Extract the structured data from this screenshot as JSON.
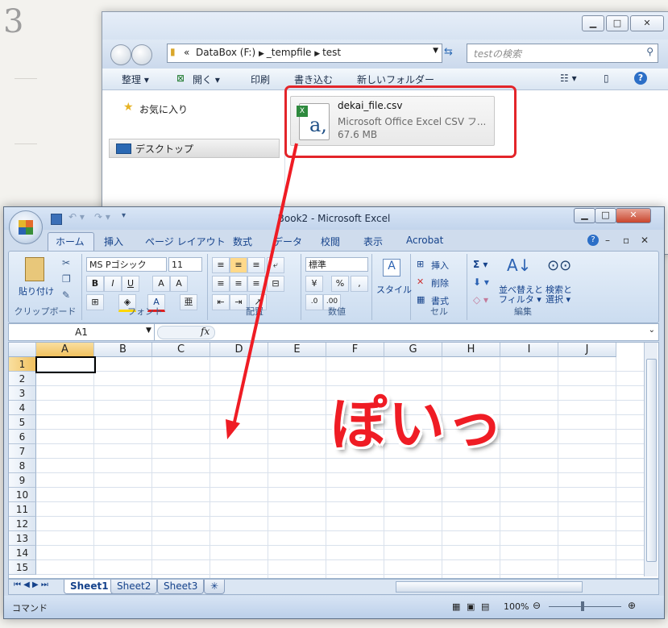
{
  "step_number": "3",
  "overlay_text": "ぽいっ",
  "explorer": {
    "address": {
      "prefix": "«",
      "crumbs": [
        "DataBox (F:)",
        "_tempfile",
        "test"
      ]
    },
    "search_placeholder": "testの検索",
    "commands": {
      "organize": "整理 ▾",
      "open": "開く ▾",
      "print": "印刷",
      "burn": "書き込む",
      "new_folder": "新しいフォルダー"
    },
    "nav": {
      "favorites": "お気に入り",
      "desktop": "デスクトップ"
    },
    "file": {
      "name": "dekai_file.csv",
      "type": "Microsoft Office Excel CSV フ...",
      "size": "67.6 MB",
      "icon": "excel-csv-icon"
    }
  },
  "excel": {
    "title": "Book2 - Microsoft Excel",
    "tabs": [
      "ホーム",
      "挿入",
      "ページ レイアウト",
      "数式",
      "データ",
      "校閲",
      "表示",
      "Acrobat"
    ],
    "ribbon": {
      "paste": "貼り付け",
      "clipboard": "クリップボード",
      "font_name": "MS Pゴシック",
      "font_size": "11",
      "font_group": "フォント",
      "align_group": "配置",
      "number_format": "標準",
      "number_group": "数値",
      "style": "スタイル",
      "insert": "挿入",
      "delete": "削除",
      "format": "書式",
      "cell_group": "セル",
      "sort_filter_1": "並べ替えと",
      "sort_filter_2": "フィルタ ▾",
      "find_select_1": "検索と",
      "find_select_2": "選択 ▾",
      "edit_group": "編集"
    },
    "name_box": "A1",
    "fx": "fx",
    "columns": [
      "A",
      "B",
      "C",
      "D",
      "E",
      "F",
      "G",
      "H",
      "I",
      "J"
    ],
    "rows": [
      "1",
      "2",
      "3",
      "4",
      "5",
      "6",
      "7",
      "8",
      "9",
      "10",
      "11",
      "12",
      "13",
      "14",
      "15"
    ],
    "sheets": [
      "Sheet1",
      "Sheet2",
      "Sheet3"
    ],
    "status": "コマンド",
    "zoom": "100%"
  },
  "colors": {
    "accent_red": "#e3252a",
    "excel_blue": "#15428b"
  }
}
